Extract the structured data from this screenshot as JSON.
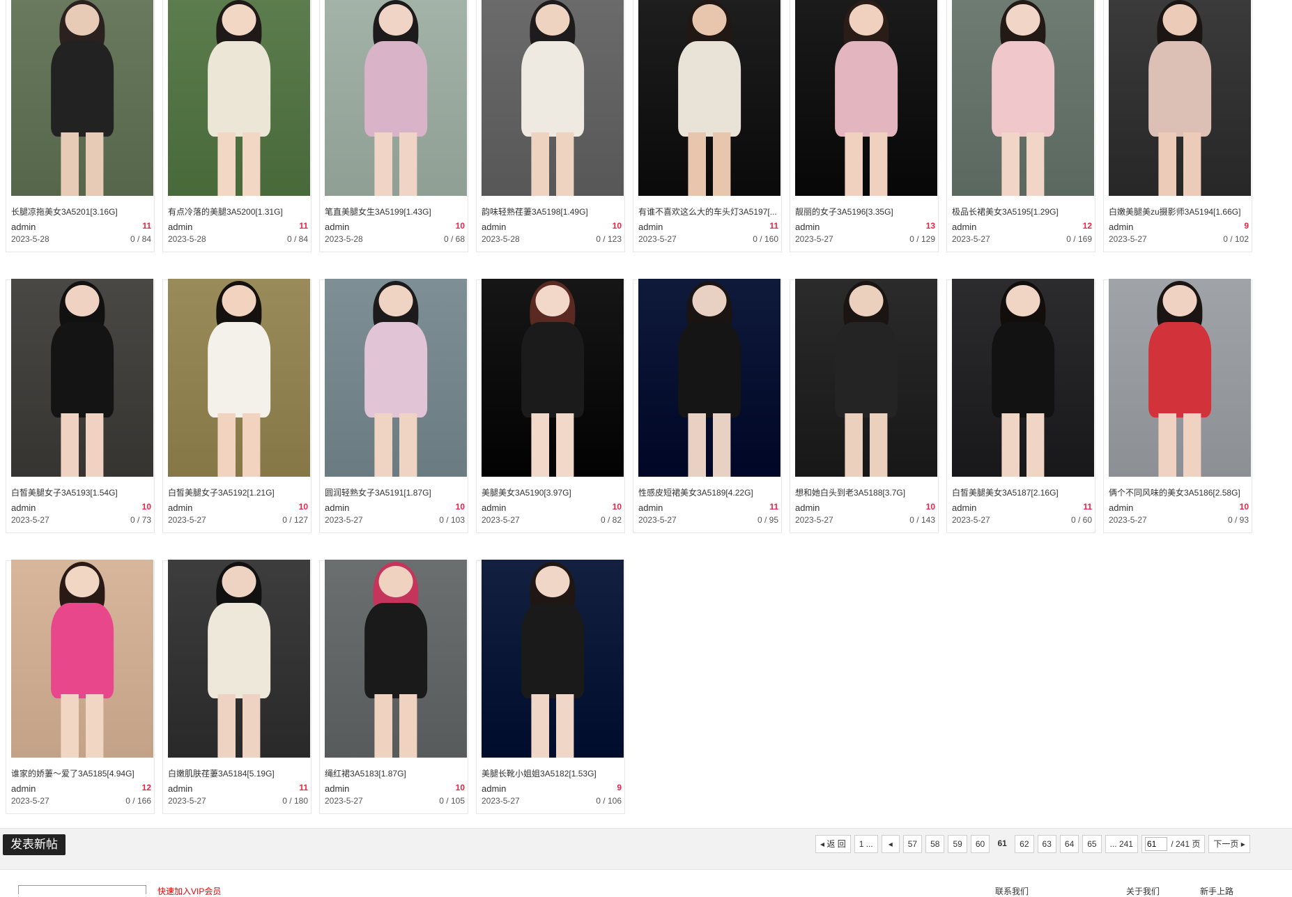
{
  "posts": [
    {
      "title": "长腿凉拖美女3A5201[3.16G]",
      "author": "admin",
      "replies": "11",
      "date": "2023-5-28",
      "views": "0 / 84",
      "palette": [
        "#6a7a5e",
        "#222",
        "#e8cbb6",
        "#2b2220"
      ]
    },
    {
      "title": "有点冷落的美腿3A5200[1.31G]",
      "author": "admin",
      "replies": "11",
      "date": "2023-5-28",
      "views": "0 / 84",
      "palette": [
        "#5c7d4d",
        "#ece6d6",
        "#f2d7c4",
        "#1f1a18"
      ]
    },
    {
      "title": "笔直美腿女生3A5199[1.43G]",
      "author": "admin",
      "replies": "10",
      "date": "2023-5-28",
      "views": "0 / 68",
      "palette": [
        "#a3b3a8",
        "#d9b4c8",
        "#f0d5c6",
        "#1c1a1a"
      ]
    },
    {
      "title": "韵味轻熟荏萋3A5198[1.49G]",
      "author": "admin",
      "replies": "10",
      "date": "2023-5-28",
      "views": "0 / 123",
      "palette": [
        "#6b6b6b",
        "#eeeae2",
        "#efd3c1",
        "#1d1b1b"
      ]
    },
    {
      "title": "有谁不喜欢这么大的车头灯3A5197[...",
      "author": "admin",
      "replies": "11",
      "date": "2023-5-27",
      "views": "0 / 160",
      "palette": [
        "#1e1e1e",
        "#e9e2d7",
        "#e8c6ae",
        "#211814"
      ]
    },
    {
      "title": "靓丽的女子3A5196[3.35G]",
      "author": "admin",
      "replies": "13",
      "date": "2023-5-27",
      "views": "0 / 129",
      "palette": [
        "#1b1b1b",
        "#e3b6bf",
        "#f0d0bf",
        "#2a1d18"
      ]
    },
    {
      "title": "极品长裙美女3A5195[1.29G]",
      "author": "admin",
      "replies": "12",
      "date": "2023-5-27",
      "views": "0 / 169",
      "palette": [
        "#6e7c73",
        "#f0c7cb",
        "#f1d6c8",
        "#231a16"
      ]
    },
    {
      "title": "白嫩美腿美zu摄影师3A5194[1.66G]",
      "author": "admin",
      "replies": "9",
      "date": "2023-5-27",
      "views": "0 / 102",
      "palette": [
        "#3b3b3b",
        "#dcc0b6",
        "#ecccb8",
        "#1b1614"
      ]
    },
    {
      "title": "白皙美腿女子3A5193[1.54G]",
      "author": "admin",
      "replies": "10",
      "date": "2023-5-27",
      "views": "0 / 73",
      "palette": [
        "#4a4845",
        "#141414",
        "#efd2c2",
        "#111"
      ]
    },
    {
      "title": "白皙美腿女子3A5192[1.21G]",
      "author": "admin",
      "replies": "10",
      "date": "2023-5-27",
      "views": "0 / 127",
      "palette": [
        "#9a8c5a",
        "#f4f0ea",
        "#f2d3bf",
        "#15110f"
      ]
    },
    {
      "title": "圆润轻熟女子3A5191[1.87G]",
      "author": "admin",
      "replies": "10",
      "date": "2023-5-27",
      "views": "0 / 103",
      "palette": [
        "#7e8f95",
        "#e1c4d6",
        "#f0d4c3",
        "#1c1a1a"
      ]
    },
    {
      "title": "美腿美女3A5190[3.97G]",
      "author": "admin",
      "replies": "10",
      "date": "2023-5-27",
      "views": "0 / 82",
      "palette": [
        "#161616",
        "#1b1b1b",
        "#f2d8c8",
        "#5a2a22"
      ]
    },
    {
      "title": "性感皮短裙美女3A5189[4.22G]",
      "author": "admin",
      "replies": "11",
      "date": "2023-5-27",
      "views": "0 / 95",
      "palette": [
        "#0f1a3a",
        "#151515",
        "#e8d0c2",
        "#1a1412"
      ]
    },
    {
      "title": "想和她白头到老3A5188[3.7G]",
      "author": "admin",
      "replies": "10",
      "date": "2023-5-27",
      "views": "0 / 143",
      "palette": [
        "#2b2b2b",
        "#242424",
        "#ecd0be",
        "#1a1412"
      ]
    },
    {
      "title": "白皙美腿美女3A5187[2.16G]",
      "author": "admin",
      "replies": "11",
      "date": "2023-5-27",
      "views": "0 / 60",
      "palette": [
        "#2c2c2e",
        "#121212",
        "#f0d4c4",
        "#120e0c"
      ]
    },
    {
      "title": "俩个不同风味的美女3A5186[2.58G]",
      "author": "admin",
      "replies": "10",
      "date": "2023-5-27",
      "views": "0 / 93",
      "palette": [
        "#a0a4a8",
        "#d2333a",
        "#efd2c1",
        "#1a1412"
      ]
    },
    {
      "title": "谁家的娇萋～爱了3A5185[4.94G]",
      "author": "admin",
      "replies": "12",
      "date": "2023-5-27",
      "views": "0 / 166",
      "palette": [
        "#d7b69c",
        "#e8478c",
        "#f2d6c4",
        "#2a1a16"
      ]
    },
    {
      "title": "白嫩肌肤荏萋3A5184[5.19G]",
      "author": "admin",
      "replies": "11",
      "date": "2023-5-27",
      "views": "0 / 180",
      "palette": [
        "#3d3d3d",
        "#eee8da",
        "#eed3c2",
        "#111"
      ]
    },
    {
      "title": "绳红裙3A5183[1.87G]",
      "author": "admin",
      "replies": "10",
      "date": "2023-5-27",
      "views": "0 / 105",
      "palette": [
        "#6b6f70",
        "#1a1a1a",
        "#f0d2c0",
        "#c5345a"
      ]
    },
    {
      "title": "美腿长靴小姐姐3A5182[1.53G]",
      "author": "admin",
      "replies": "9",
      "date": "2023-5-27",
      "views": "0 / 106",
      "palette": [
        "#142040",
        "#1a1a1a",
        "#efd6c6",
        "#201714"
      ]
    }
  ],
  "toolbar": {
    "post_button": "发表新帖",
    "back_label": "返 回",
    "first_label": "1 ...",
    "pages": [
      "57",
      "58",
      "59",
      "60"
    ],
    "current_page": "61",
    "next_pages": [
      "62",
      "63",
      "64",
      "65"
    ],
    "last_label": "... 241",
    "jump_value": "61",
    "total_label": "/ 241 页",
    "next_label": "下一页"
  },
  "footer": {
    "red_text": "快速加入VIP会员",
    "links": [
      "联系我们",
      "关于我们",
      "新手上路"
    ]
  }
}
